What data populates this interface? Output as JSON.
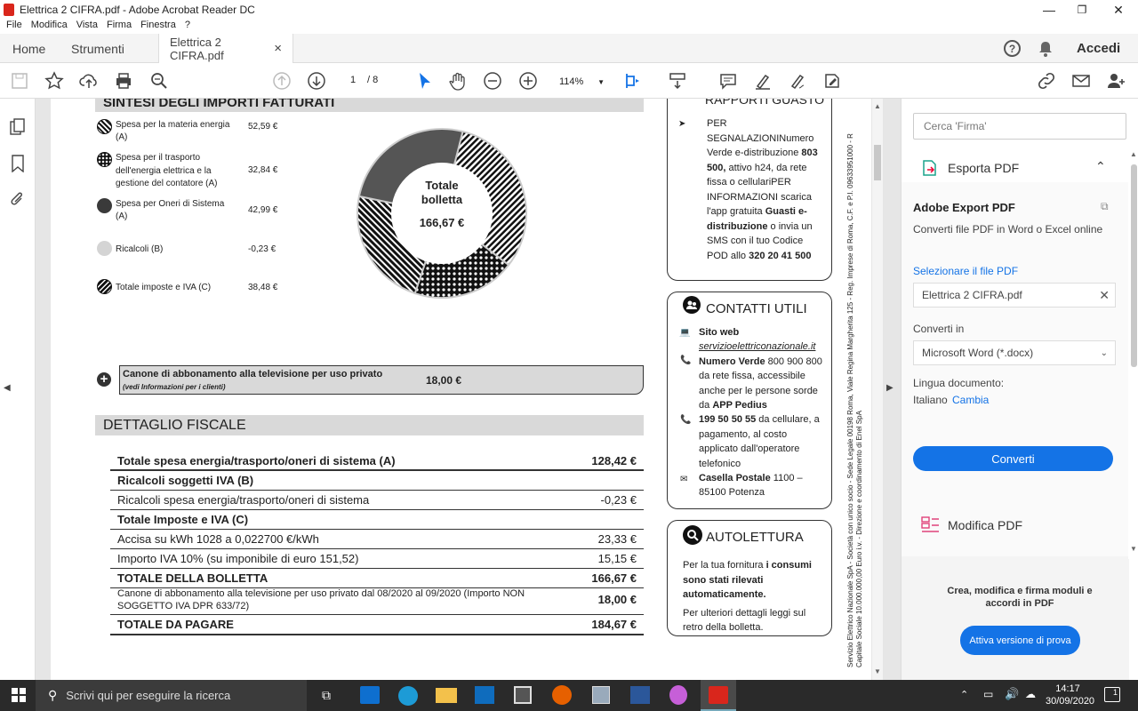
{
  "window": {
    "title": "Elettrica 2 CIFRA.pdf - Adobe Acrobat Reader DC",
    "minimize": "—",
    "maximize": "❐",
    "close": "✕"
  },
  "menu": [
    "File",
    "Modifica",
    "Vista",
    "Firma",
    "Finestra",
    "?"
  ],
  "tabs": {
    "home": "Home",
    "tools": "Strumenti",
    "doc": "Elettrica 2 CIFRA.pdf",
    "close": "×",
    "signin": "Accedi"
  },
  "toolbar": {
    "page_current": "1",
    "page_total": "/ 8",
    "zoom": "114%"
  },
  "invoice": {
    "summary_title": "SINTESI DEGLI IMPORTI FATTURATI",
    "legend": [
      {
        "label": "Spesa per la materia energia (A)",
        "value": "52,59 €"
      },
      {
        "label": "Spesa per il trasporto dell'energia elettrica e la gestione del contatore (A)",
        "value": "32,84 €"
      },
      {
        "label": "Spesa per Oneri di Sistema (A)",
        "value": "42,99 €"
      },
      {
        "label": "Ricalcoli (B)",
        "value": "-0,23 €"
      },
      {
        "label": "Totale imposte e IVA (C)",
        "value": "38,48 €"
      }
    ],
    "donut_center_l1": "Totale",
    "donut_center_l2": "bolletta",
    "donut_center_value": "166,67 €",
    "canone_label": "Canone di abbonamento alla televisione per uso privato",
    "canone_sub": "(vedi Informazioni per i clienti)",
    "canone_value": "18,00 €",
    "fiscal_title": "DETTAGLIO FISCALE",
    "fiscal_rows": [
      {
        "label": "Totale spesa energia/trasporto/oneri di sistema (A)",
        "value": "128,42 €",
        "bold": true
      },
      {
        "label": "Ricalcoli soggetti IVA (B)",
        "value": "",
        "bold": true
      },
      {
        "label": "Ricalcoli spesa energia/trasporto/oneri di sistema",
        "value": "-0,23 €",
        "bold": false
      },
      {
        "label": "Totale Imposte e IVA (C)",
        "value": "",
        "bold": true
      },
      {
        "label": "Accisa su kWh 1028 a 0,022700 €/kWh",
        "value": "23,33 €",
        "bold": false
      },
      {
        "label": "Importo IVA 10% (su imponibile di euro 151,52)",
        "value": "15,15 €",
        "bold": false
      },
      {
        "label": "TOTALE DELLA BOLLETTA",
        "value": "166,67 €",
        "bold": true
      }
    ],
    "canone_row_label": "Canone di abbonamento alla televisione per uso privato dal 08/2020 al 09/2020 (Importo NON SOGGETTO IVA DPR 633/72)",
    "canone_row_value": "18,00 €",
    "total_pay_label": "TOTALE DA PAGARE",
    "total_pay_value": "184,67 €"
  },
  "side": {
    "guasti_title": "RAPPORTI GUASTO",
    "guasti_text_1": "PER SEGNALAZIONINumero Verde e-distribuzione",
    "guasti_num": "803 500,",
    "guasti_text_2": "attivo h24, da rete fissa o cellulariPER INFORMAZIONI",
    "guasti_text_3": "scarica l'app gratuita",
    "guasti_bold": "Guasti e-distribuzione",
    "guasti_text_4": "o invia un SMS con il tuo Codice POD allo",
    "guasti_sms": "320 20 41 500",
    "contatti_title": "CONTATTI UTILI",
    "web_label": "Sito web",
    "web_url": "servizioelettriconazionale.it",
    "verde_label": "Numero Verde",
    "verde_text": "800 900 800 da rete fissa, accessibile anche per le persone sorde da",
    "app_label": "APP Pedius",
    "cell_num": "199 50 50 55",
    "cell_text": "da cellulare, a pagamento, al costo applicato dall'operatore telefonico",
    "casella_label": "Casella Postale",
    "casella_text": "1100 – 85100 Potenza",
    "auto_title": "AUTOLETTURA",
    "auto_text_1": "Per la tua fornitura",
    "auto_bold": "i consumi sono stati rilevati automaticamente.",
    "auto_text_2": "Per ulteriori dettagli leggi sul retro della bolletta.",
    "vertical_1": "Servizio Elettrico Nazionale SpA - Società con unico socio - Sede Legale 00198 Roma, Viale Regina Margherita 125 - Reg. Imprese di Roma, C.F. e P.I. 09633951000 - R",
    "vertical_2": "Capitale Sociale 10.000.000,00 Euro i.v. - Direzione e coordinamento di Enel SpA"
  },
  "panel": {
    "search_placeholder": "Cerca 'Firma'",
    "export_title": "Esporta PDF",
    "adobe_export": "Adobe Export PDF",
    "adobe_desc": "Converti file PDF in Word o Excel online",
    "select_file": "Selezionare il file PDF",
    "file_name": "Elettrica 2 CIFRA.pdf",
    "convert_in": "Converti in",
    "format": "Microsoft Word (*.docx)",
    "lang_label": "Lingua documento:",
    "lang_value": "Italiano",
    "lang_change": "Cambia",
    "convert_btn": "Converti",
    "edit_pdf": "Modifica PDF",
    "promo": "Crea, modifica e firma moduli e accordi in PDF",
    "trial_btn": "Attiva versione di prova"
  },
  "taskbar": {
    "search": "Scrivi qui per eseguire la ricerca",
    "time": "14:17",
    "date": "30/09/2020",
    "notif": "1"
  },
  "colors": {
    "accent": "#1473e6",
    "pdf_red": "#d9261c",
    "taskbar": "#2a2a2a"
  }
}
